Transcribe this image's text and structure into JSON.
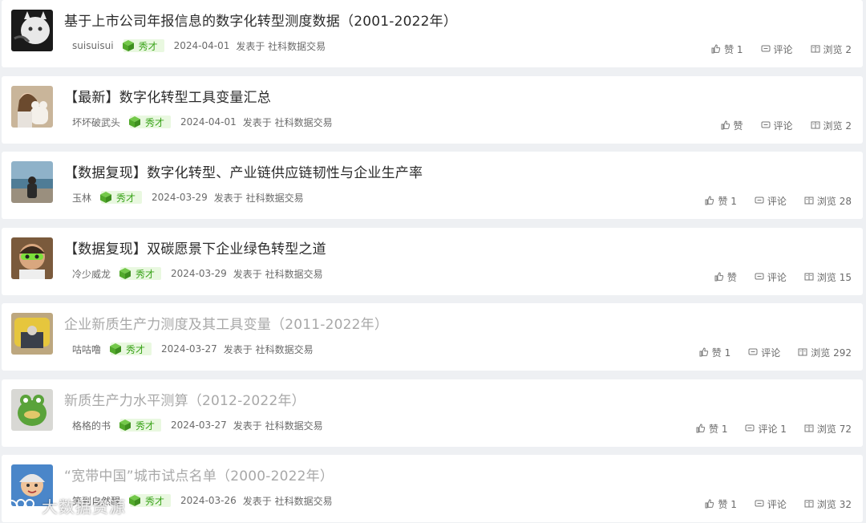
{
  "posts": [
    {
      "title": "基于上市公司年报信息的数字化转型测度数据（2001-2022年）",
      "author": "suisuisui",
      "badge": "秀才",
      "date": "2024-04-01",
      "source": "发表于 社科数据交易",
      "likes": "赞 1",
      "comments": "评论",
      "views": "浏览 2",
      "faded": false,
      "avatar": "cat-photo"
    },
    {
      "title": "【最新】数字化转型工具变量汇总",
      "author": "坏坏破武头",
      "badge": "秀才",
      "date": "2024-04-01",
      "source": "发表于 社科数据交易",
      "likes": "赞",
      "comments": "评论",
      "views": "浏览 2",
      "faded": false,
      "avatar": "girl-with-toy"
    },
    {
      "title": "【数据复现】数字化转型、产业链供应链韧性与企业生产率",
      "author": "玉林",
      "badge": "秀才",
      "date": "2024-03-29",
      "source": "发表于 社科数据交易",
      "likes": "赞 1",
      "comments": "评论",
      "views": "浏览 28",
      "faded": false,
      "avatar": "person-at-sea"
    },
    {
      "title": "【数据复现】双碳愿景下企业绿色转型之道",
      "author": "冷少威龙",
      "badge": "秀才",
      "date": "2024-03-29",
      "source": "发表于 社科数据交易",
      "likes": "赞",
      "comments": "评论",
      "views": "浏览 15",
      "faded": false,
      "avatar": "kid-with-mask"
    },
    {
      "title": "企业新质生产力测度及其工具变量（2011-2022年）",
      "author": "咕咕噜",
      "badge": "秀才",
      "date": "2024-03-27",
      "source": "发表于 社科数据交易",
      "likes": "赞 1",
      "comments": "评论",
      "views": "浏览 292",
      "faded": true,
      "avatar": "yellow-chair"
    },
    {
      "title": "新质生产力水平测算（2012-2022年）",
      "author": "格格的书",
      "badge": "秀才",
      "date": "2024-03-27",
      "source": "发表于 社科数据交易",
      "likes": "赞 1",
      "comments": "评论 1",
      "views": "浏览 72",
      "faded": true,
      "avatar": "green-frog"
    },
    {
      "title": "“宽带中国”城市试点名单（2000-2022年）",
      "author": "笑到自然醒",
      "badge": "秀才",
      "date": "2024-03-26",
      "source": "发表于 社科数据交易",
      "likes": "赞 1",
      "comments": "评论",
      "views": "浏览 32",
      "faded": true,
      "avatar": "baby-photo"
    }
  ],
  "watermark": "大数据资源",
  "colors": {
    "badge_bg": "#e9f8e0",
    "badge_text": "#3aa31a",
    "page_bg": "#eef0f3"
  },
  "icons": {
    "like": "thumbs-up-icon",
    "comment": "comment-icon",
    "view": "book-icon",
    "badge": "cube-icon"
  }
}
